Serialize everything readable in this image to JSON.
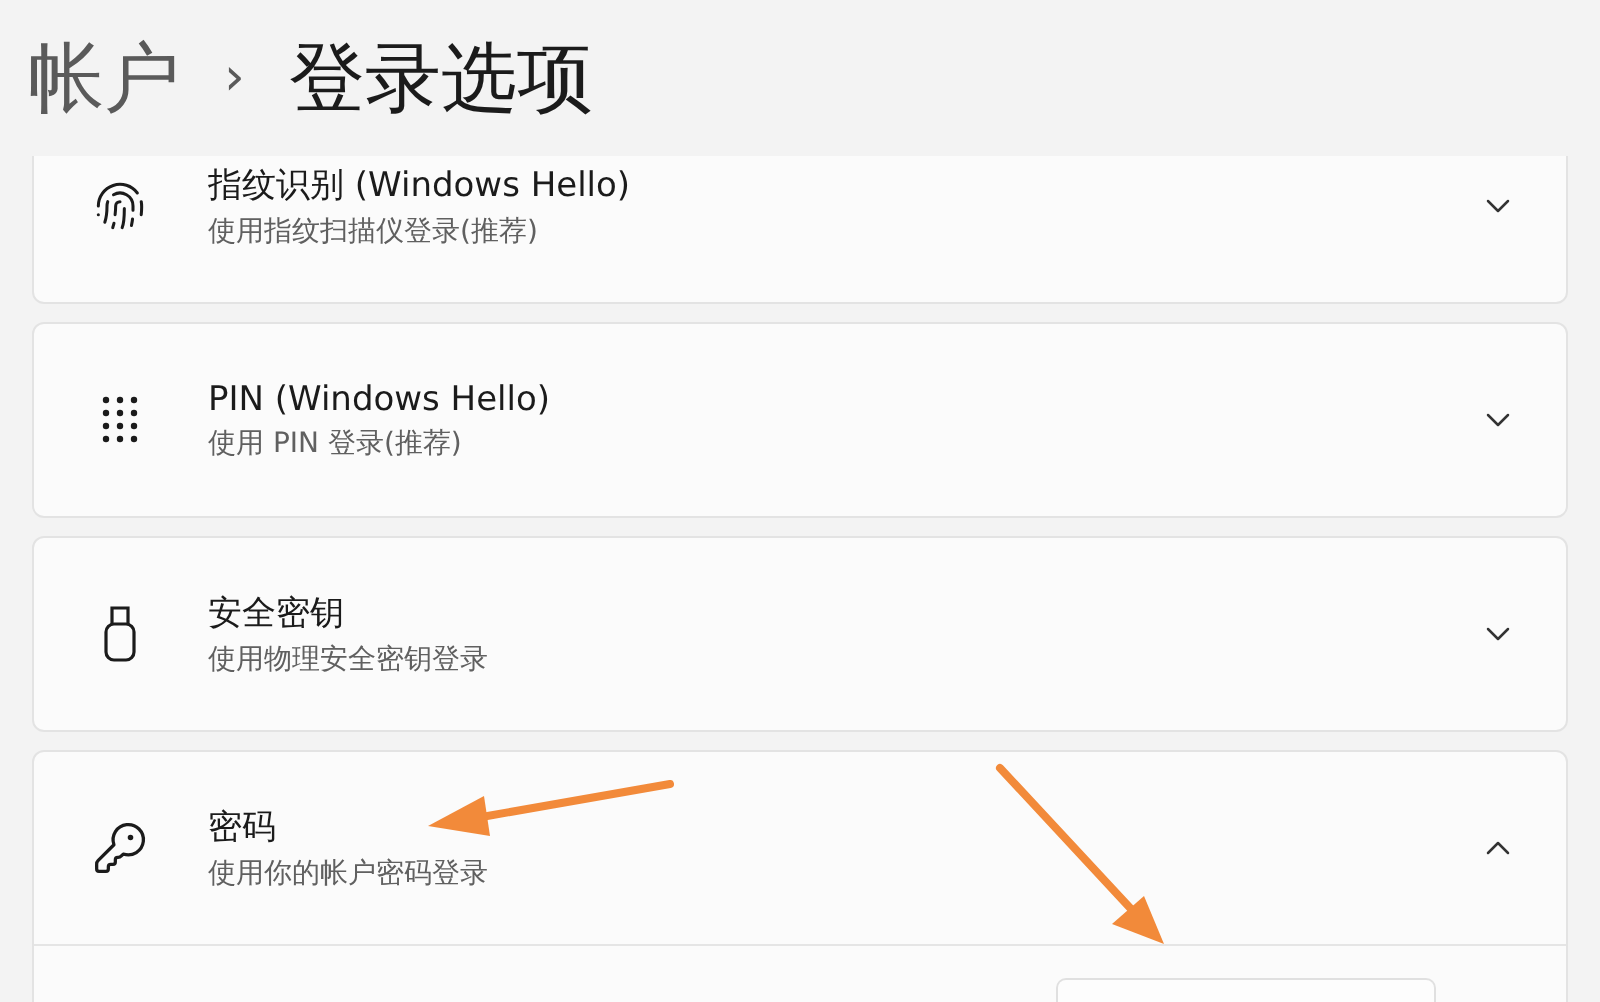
{
  "breadcrumb": {
    "parent": "帐户",
    "separator": "›",
    "current": "登录选项"
  },
  "options": [
    {
      "kind": "fingerprint",
      "title": "指纹识别 (Windows Hello)",
      "subtitle": "使用指纹扫描仪登录(推荐)",
      "expanded": false
    },
    {
      "kind": "pin",
      "title": "PIN (Windows Hello)",
      "subtitle": "使用 PIN 登录(推荐)",
      "expanded": false
    },
    {
      "kind": "security-key",
      "title": "安全密钥",
      "subtitle": "使用物理安全密钥登录",
      "expanded": false
    },
    {
      "kind": "password",
      "title": "密码",
      "subtitle": "使用你的帐户密码登录",
      "expanded": true
    }
  ]
}
